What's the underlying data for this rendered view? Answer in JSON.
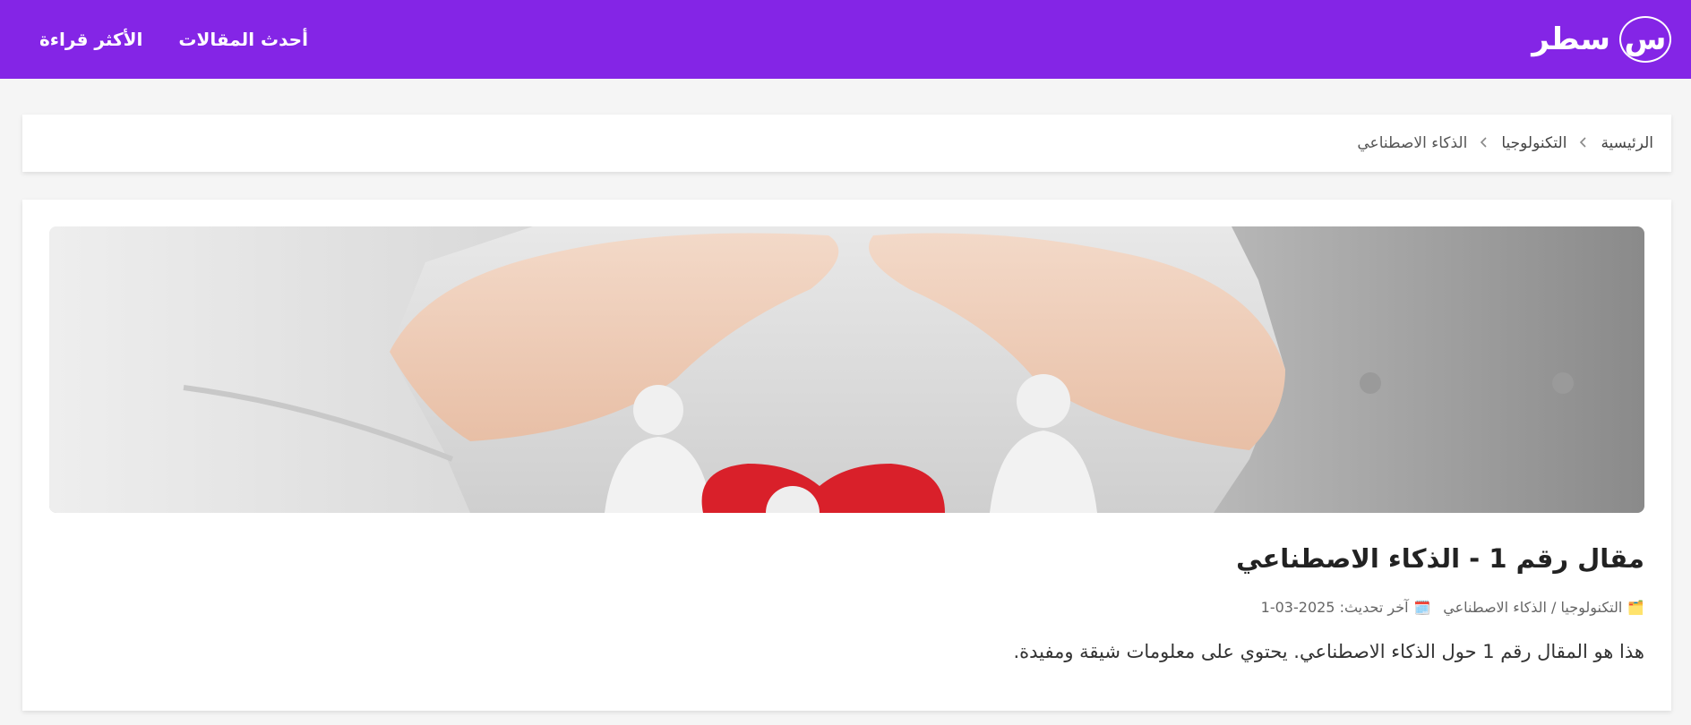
{
  "navbar": {
    "logo_letter": "س",
    "brand_name": "سطر",
    "links": [
      {
        "label": "أحدث المقالات"
      },
      {
        "label": "الأكثر قراءة"
      }
    ],
    "background_color": "#8425e6"
  },
  "breadcrumb": {
    "items": [
      {
        "label": "الرئيسية"
      },
      {
        "label": "التكنولوجيا"
      },
      {
        "label": "الذكاء الاصطناعي"
      }
    ],
    "separator_icon": "chevron-left-icon"
  },
  "article": {
    "image_description_icon": "article-hero-image",
    "title": "مقال رقم 1 - الذكاء الاصطناعي",
    "category": "التكنولوجيا / الذكاء الاصطناعي",
    "category_icon": "folder-icon",
    "updated_label": "آخر تحديث: 2025-03-1",
    "updated_icon": "calendar-icon",
    "excerpt": "هذا هو المقال رقم 1 حول الذكاء الاصطناعي. يحتوي على معلومات شيقة ومفيدة."
  }
}
